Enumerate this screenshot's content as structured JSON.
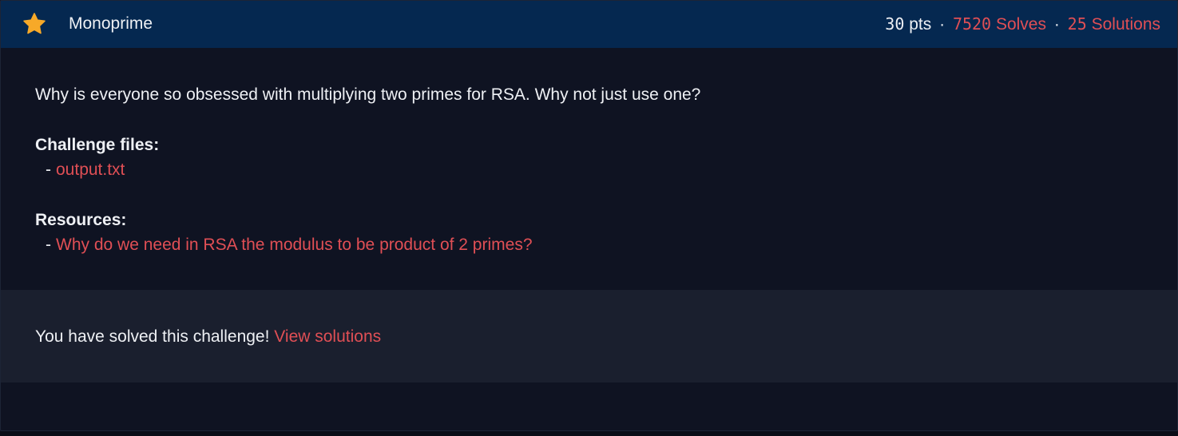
{
  "challenge": {
    "title": "Monoprime",
    "starred": true,
    "points_value": "30",
    "points_unit": "pts",
    "separator": "·",
    "solves_count": "7520",
    "solves_label": "Solves",
    "solutions_count": "25",
    "solutions_label": "Solutions"
  },
  "description": "Why is everyone so obsessed with multiplying two primes for RSA. Why not just use one?",
  "files": {
    "heading": "Challenge files:",
    "items": [
      {
        "dash": "-",
        "label": "output.txt"
      }
    ]
  },
  "resources": {
    "heading": "Resources:",
    "items": [
      {
        "dash": "-",
        "label": "Why do we need in RSA the modulus to be product of 2 primes?"
      }
    ]
  },
  "status": {
    "message": "You have solved this challenge!",
    "link_label": "View solutions"
  },
  "colors": {
    "header_bg": "#052850",
    "body_bg": "#0f1322",
    "footer_bg": "#1a1f2e",
    "accent": "#e04f55",
    "star": "#f7a928",
    "text": "#eef0f4"
  },
  "icons": {
    "star": "star-icon"
  }
}
